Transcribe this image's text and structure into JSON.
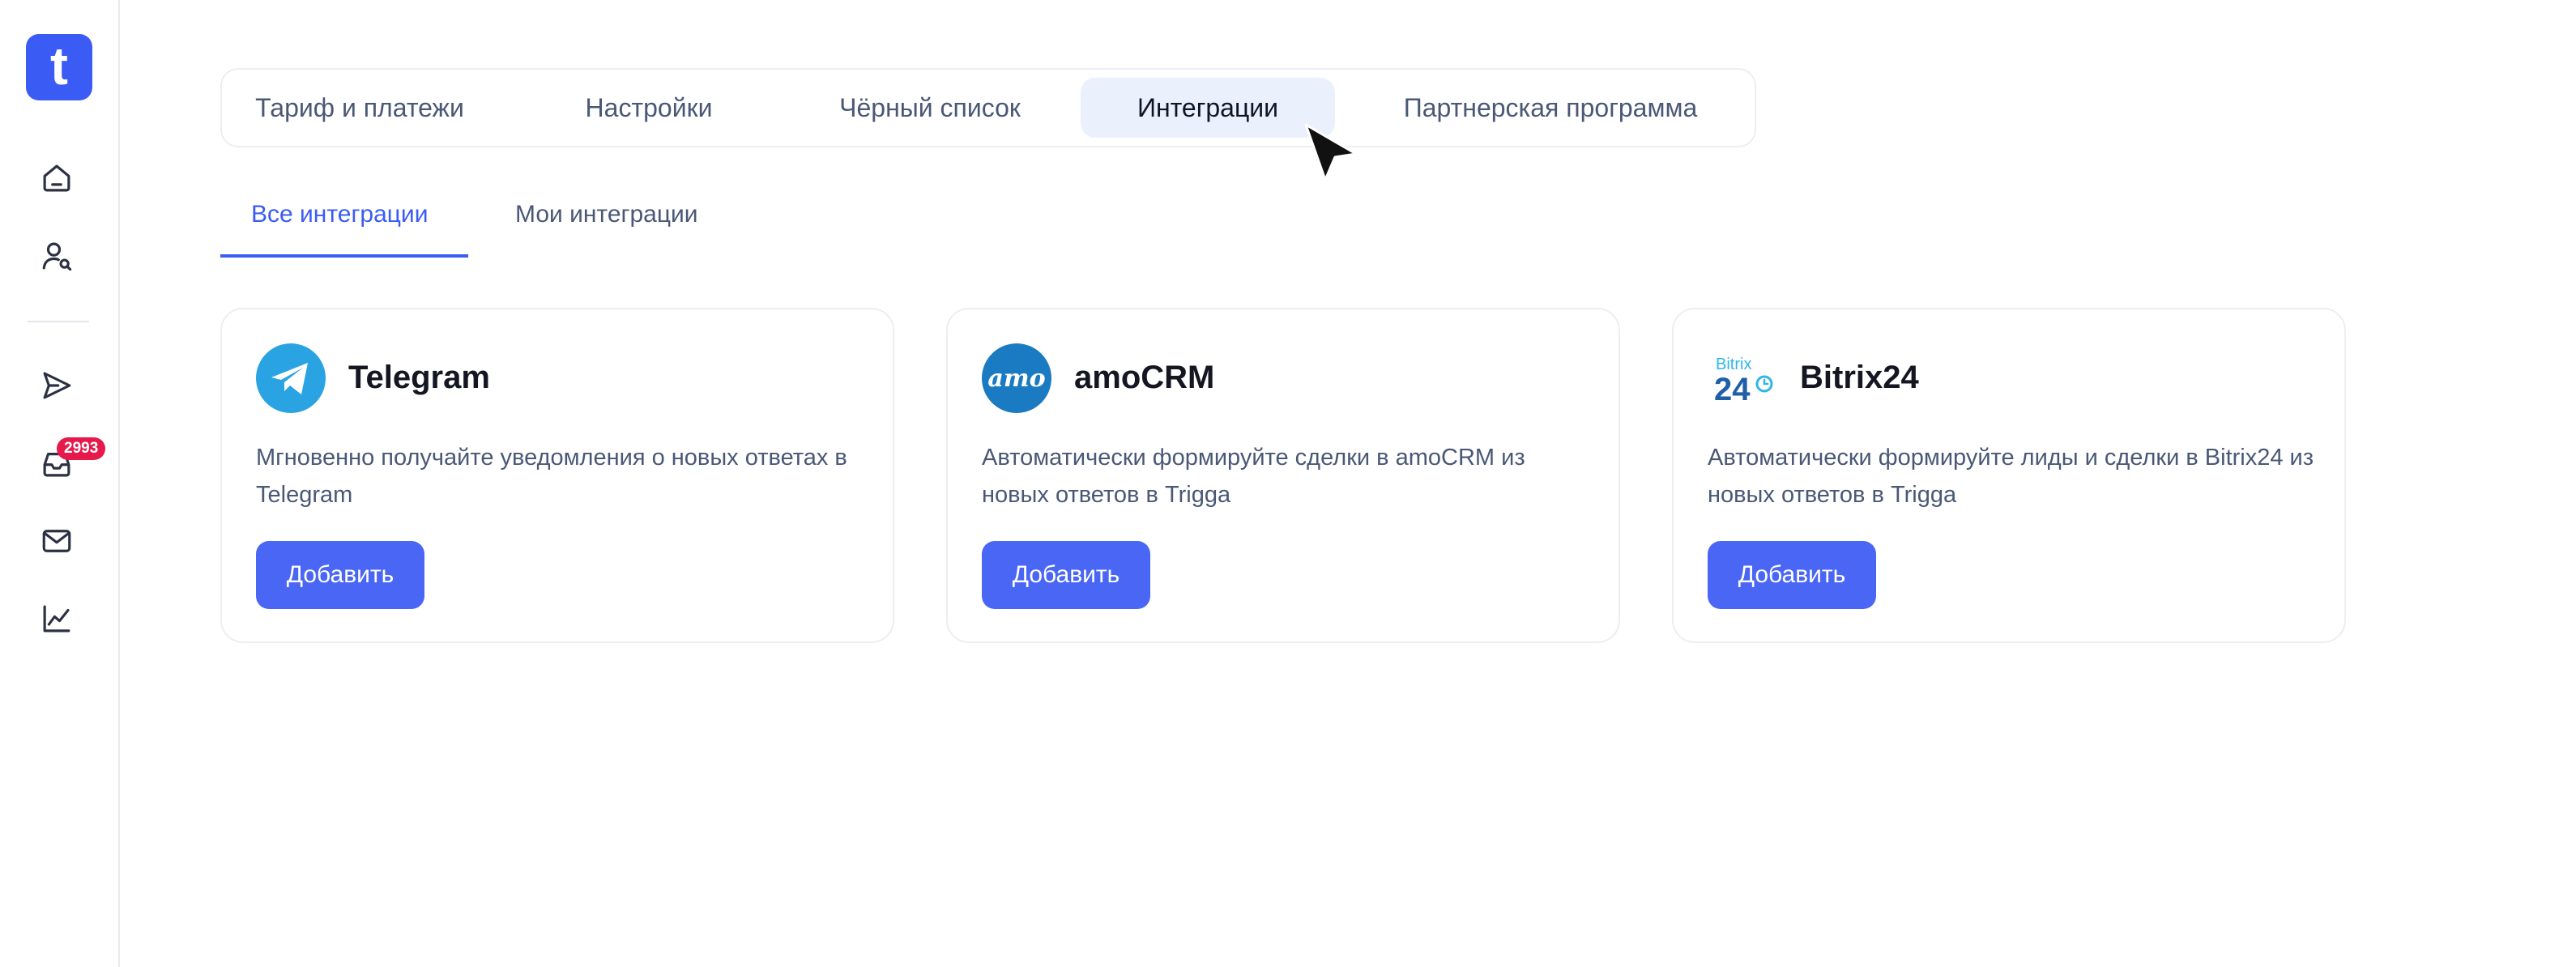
{
  "sidebar": {
    "logo_letter": "t",
    "inbox_badge": "2993",
    "items": [
      {
        "name": "home-icon"
      },
      {
        "name": "user-search-icon"
      },
      {
        "name": "send-icon"
      },
      {
        "name": "inbox-icon"
      },
      {
        "name": "mail-icon"
      },
      {
        "name": "chart-icon"
      }
    ]
  },
  "tabs": {
    "items": [
      "Тариф и платежи",
      "Настройки",
      "Чёрный список",
      "Интеграции",
      "Партнерская программа"
    ],
    "active": "Интеграции"
  },
  "subtabs": {
    "all": "Все интеграции",
    "mine": "Мои интеграции",
    "active": "Все интеграции"
  },
  "cards": [
    {
      "title": "Telegram",
      "logo": "telegram-logo",
      "desc": "Мгновенно получайте уведомления о новых ответах в Telegram",
      "button": "Добавить"
    },
    {
      "title": "amoCRM",
      "logo": "amocrm-logo",
      "logo_text": "amo",
      "desc": "Автоматически формируйте сделки в amoCRM из новых ответов в Trigga",
      "button": "Добавить"
    },
    {
      "title": "Bitrix24",
      "logo": "bitrix24-logo",
      "logo_text_top": "Bitrix",
      "logo_text_bottom": "24",
      "desc": "Автоматически формируйте лиды и сделки в Bitrix24 из новых ответов в Trigga",
      "button": "Добавить"
    }
  ],
  "colors": {
    "accent": "#3b5bf5",
    "button": "#4a66f5",
    "badge": "#e6194b",
    "telegram": "#2aa3e3",
    "amocrm": "#1b7bc2",
    "bitrix_top": "#2fb6e8",
    "bitrix_bottom": "#1f5fa8"
  }
}
